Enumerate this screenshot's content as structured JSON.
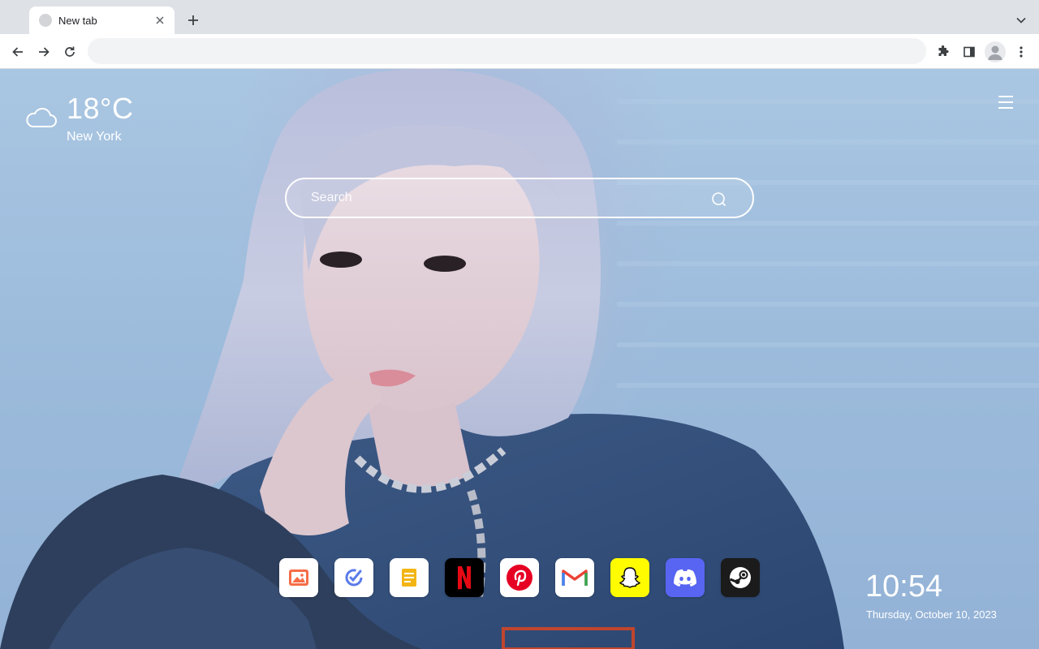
{
  "browser": {
    "tab": {
      "title": "New tab"
    },
    "omnibox": {
      "value": "",
      "placeholder": ""
    }
  },
  "weather": {
    "icon": "cloud-icon",
    "temperature": "18°C",
    "city": "New York"
  },
  "search": {
    "placeholder": "Search"
  },
  "shortcuts": [
    {
      "name": "Photos",
      "icon": "image-icon",
      "color": "#f56d47"
    },
    {
      "name": "Tasks",
      "icon": "checkmark-icon",
      "color": "#5b7bea"
    },
    {
      "name": "Notes",
      "icon": "note-icon",
      "color": "#f2b514"
    },
    {
      "name": "Netflix",
      "icon": "netflix-icon",
      "color": "#e50914"
    },
    {
      "name": "Pinterest",
      "icon": "pinterest-icon",
      "color": "#e60023"
    },
    {
      "name": "Gmail",
      "icon": "gmail-icon",
      "color": "#ea4335"
    },
    {
      "name": "Snapchat",
      "icon": "snapchat-icon",
      "color": "#fffc00"
    },
    {
      "name": "Discord",
      "icon": "discord-icon",
      "color": "#5865f2"
    },
    {
      "name": "Steam",
      "icon": "steam-icon",
      "color": "#1b1b1b"
    }
  ],
  "clock": {
    "time": "10:54",
    "date": "Thursday, October 10, 2023"
  }
}
